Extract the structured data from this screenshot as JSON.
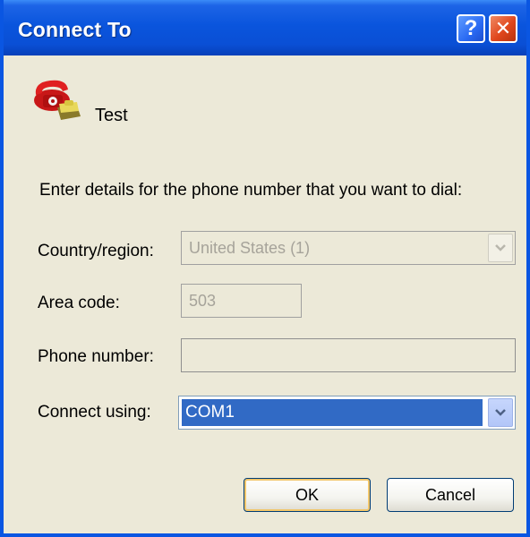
{
  "window": {
    "title": "Connect To"
  },
  "connection": {
    "name": "Test",
    "icon": "telephone-icon"
  },
  "instructions": "Enter details for the phone number that you want to dial:",
  "form": {
    "country_label": "Country/region:",
    "country_value": "United States (1)",
    "area_code_label": "Area code:",
    "area_code_value": "503",
    "phone_label": "Phone number:",
    "phone_value": "",
    "connect_using_label": "Connect using:",
    "connect_using_value": "COM1"
  },
  "buttons": {
    "ok": "OK",
    "cancel": "Cancel",
    "help": "?",
    "close": "✕"
  },
  "colors": {
    "titlebar": "#0a55dd",
    "selection": "#316ac5",
    "dialog_bg": "#ece9d8",
    "close_button": "#e0471d"
  }
}
